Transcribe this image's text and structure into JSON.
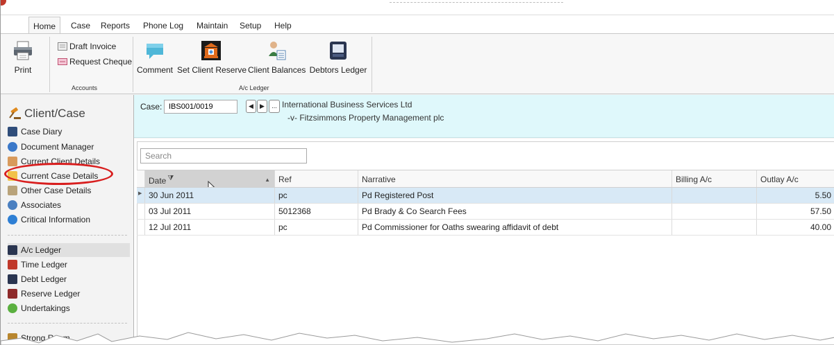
{
  "menu": {
    "tabs": [
      "Home",
      "Case",
      "Reports",
      "Phone Log",
      "Maintain",
      "Setup",
      "Help"
    ]
  },
  "ribbon": {
    "print_label": "Print",
    "draft_invoice_label": "Draft Invoice",
    "request_cheque_label": "Request Cheque",
    "accounts_group_label": "Accounts",
    "comment_label": "Comment",
    "set_client_reserve_label": "Set Client Reserve",
    "client_balances_label": "Client Balances",
    "debtors_ledger_label": "Debtors Ledger",
    "ac_ledger_group_label": "A/c Ledger"
  },
  "sidebar": {
    "title": "Client/Case",
    "items_top": [
      "Case Diary",
      "Document Manager",
      "Current Client Details",
      "Current Case Details",
      "Other Case Details",
      "Associates",
      "Critical Information"
    ],
    "items_ledgers": [
      "A/c Ledger",
      "Time Ledger",
      "Debt Ledger",
      "Reserve Ledger",
      "Undertakings"
    ],
    "items_bottom": [
      "Strong Room"
    ],
    "selected": "A/c Ledger"
  },
  "case": {
    "label": "Case:",
    "value": "IBS001/0019",
    "ellipsis": "...",
    "party1": "International Business Services Ltd",
    "party2": "-v- Fitzsimmons Property Management plc"
  },
  "grid": {
    "search_placeholder": "Search",
    "columns": [
      "Date",
      "Ref",
      "Narrative",
      "Billing A/c",
      "Outlay A/c"
    ],
    "rows": [
      {
        "date": "30 Jun 2011",
        "ref": "pc",
        "narrative": "Pd Registered Post",
        "billing": "",
        "outlay": "5.50"
      },
      {
        "date": "03 Jul 2011",
        "ref": "5012368",
        "narrative": "Pd Brady & Co Search Fees",
        "billing": "",
        "outlay": "57.50"
      },
      {
        "date": "12 Jul 2011",
        "ref": "pc",
        "narrative": "Pd Commissioner for Oaths swearing affidavit of debt",
        "billing": "",
        "outlay": "40.00"
      }
    ]
  },
  "colors": {
    "case_panel_bg": "#dff8fb",
    "selected_row_bg": "#d8e9f6",
    "highlight_ring": "#d81e1e"
  }
}
